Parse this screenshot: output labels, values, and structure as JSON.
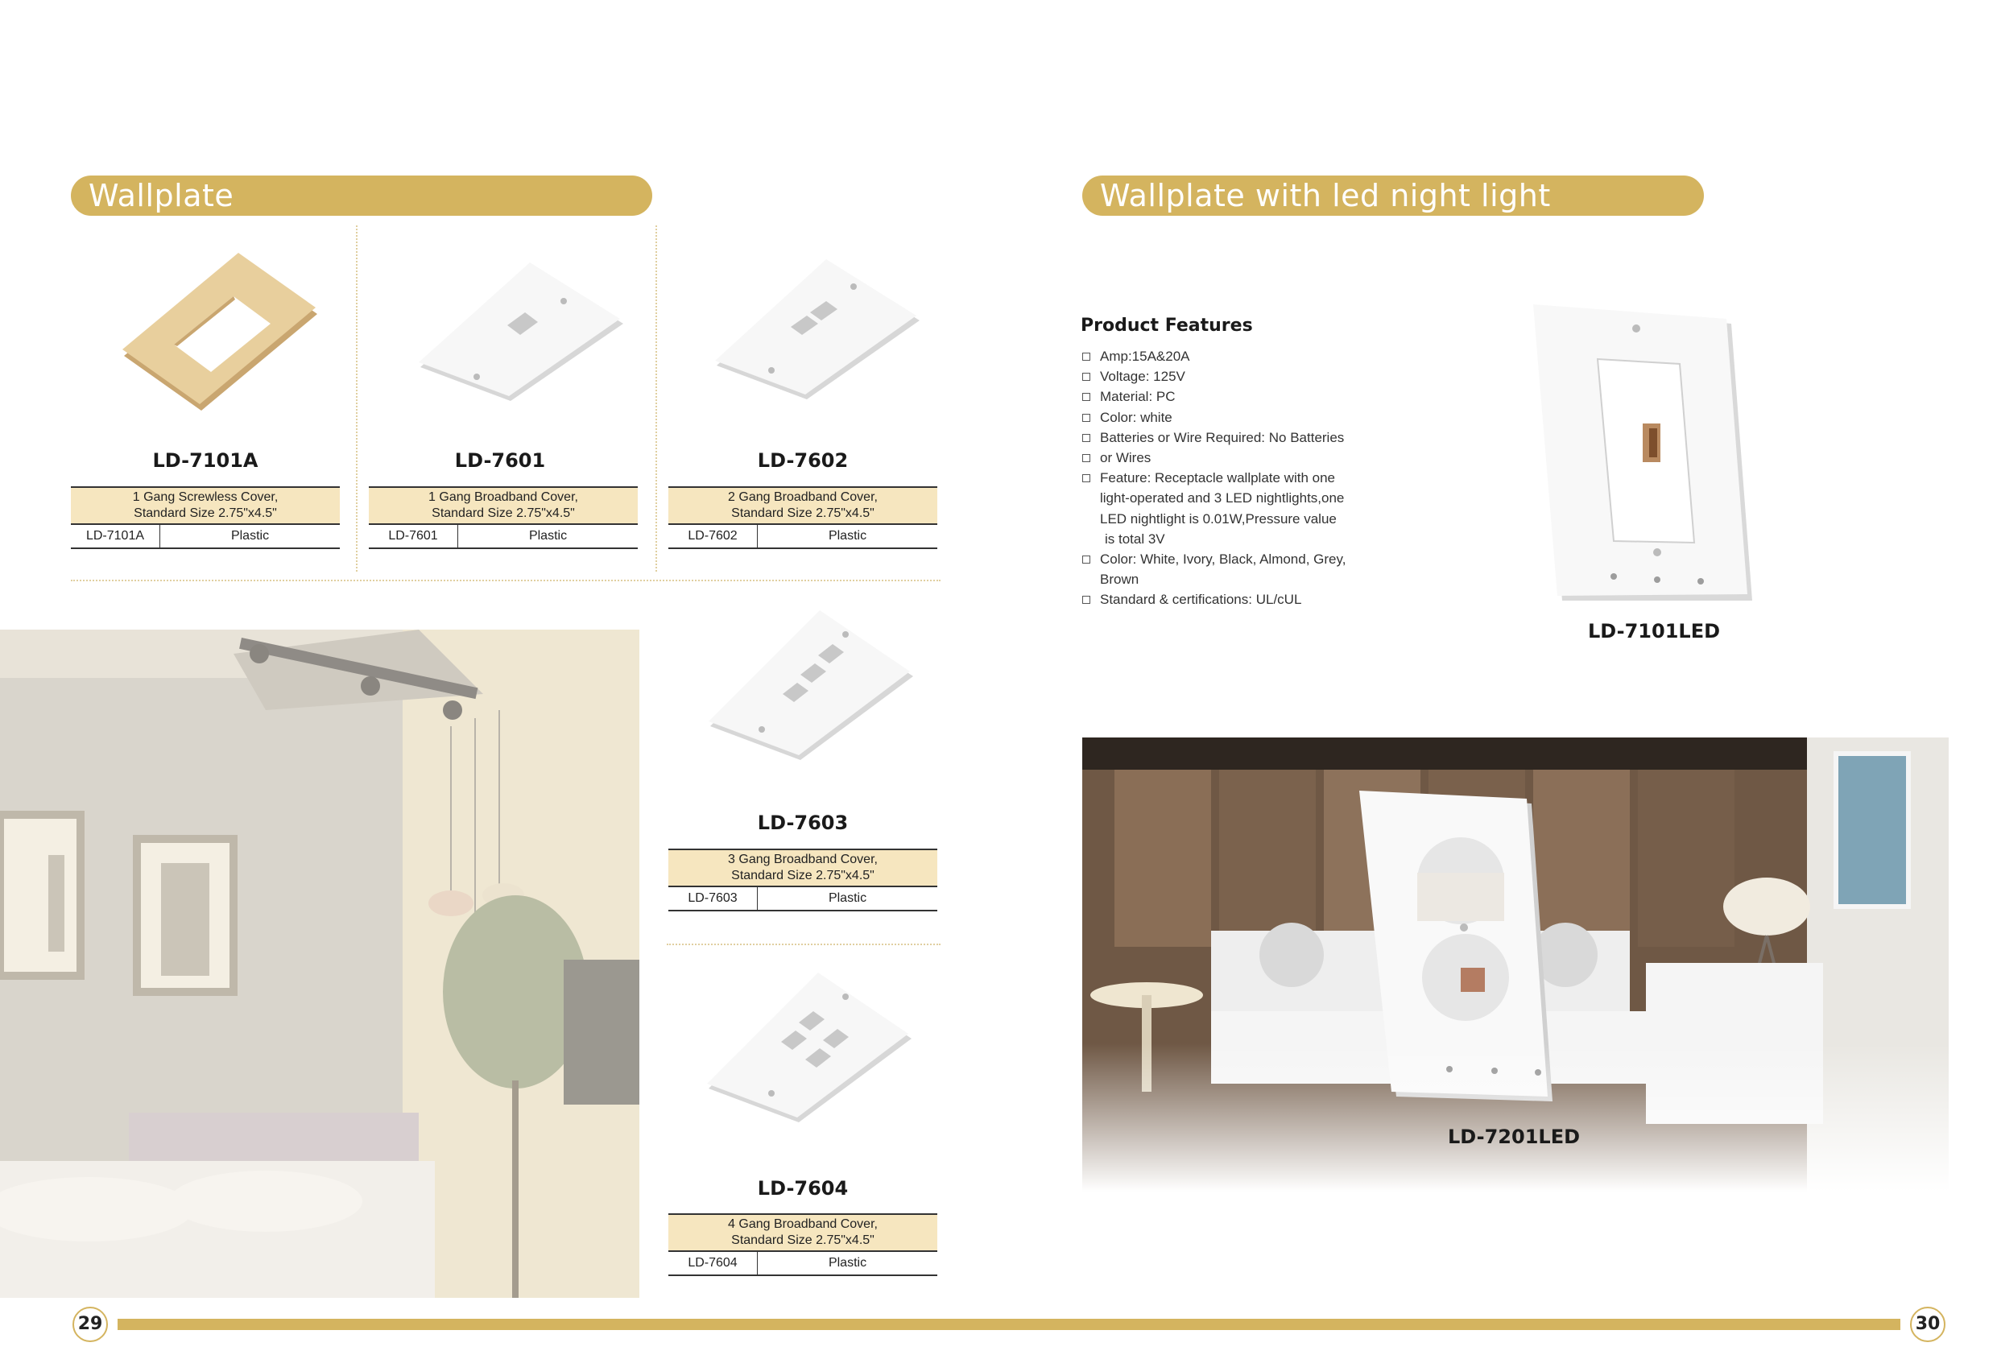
{
  "left": {
    "section_title": "Wallplate",
    "products": [
      {
        "model": "LD-7101A",
        "desc_line1": "1 Gang Screwless Cover,",
        "desc_line2": "Standard Size 2.75\"x4.5\"",
        "code": "LD-7101A",
        "material": "Plastic"
      },
      {
        "model": "LD-7601",
        "desc_line1": "1 Gang Broadband Cover,",
        "desc_line2": "Standard Size 2.75\"x4.5\"",
        "code": "LD-7601",
        "material": "Plastic"
      },
      {
        "model": "LD-7602",
        "desc_line1": "2 Gang Broadband Cover,",
        "desc_line2": "Standard Size 2.75\"x4.5\"",
        "code": "LD-7602",
        "material": "Plastic"
      },
      {
        "model": "LD-7603",
        "desc_line1": "3 Gang Broadband Cover,",
        "desc_line2": "Standard Size 2.75\"x4.5\"",
        "code": "LD-7603",
        "material": "Plastic"
      },
      {
        "model": "LD-7604",
        "desc_line1": "4 Gang Broadband Cover,",
        "desc_line2": "Standard Size 2.75\"x4.5\"",
        "code": "LD-7604",
        "material": "Plastic"
      }
    ],
    "page_number": "29"
  },
  "right": {
    "section_title": "Wallplate with led night light",
    "features_title": "Product Features",
    "features": [
      "Amp:15A&20A",
      "Voltage: 125V",
      "Material: PC",
      "Color: white",
      "Batteries or Wire Required: No Batteries",
      "or Wires",
      "Feature: Receptacle wallplate with  one",
      "light-operated and 3 LED nightlights,one",
      "LED nightlight is 0.01W,Pressure value",
      " is total 3V",
      "Color: White, Ivory, Black, Almond, Grey,",
      "Brown",
      "Standard & certifications: UL/cUL"
    ],
    "product1_model": "LD-7101LED",
    "product2_model": "LD-7201LED",
    "page_number": "30"
  },
  "colors": {
    "accent_gold": "#d4b45f",
    "table_fill": "#f6e6bf"
  }
}
